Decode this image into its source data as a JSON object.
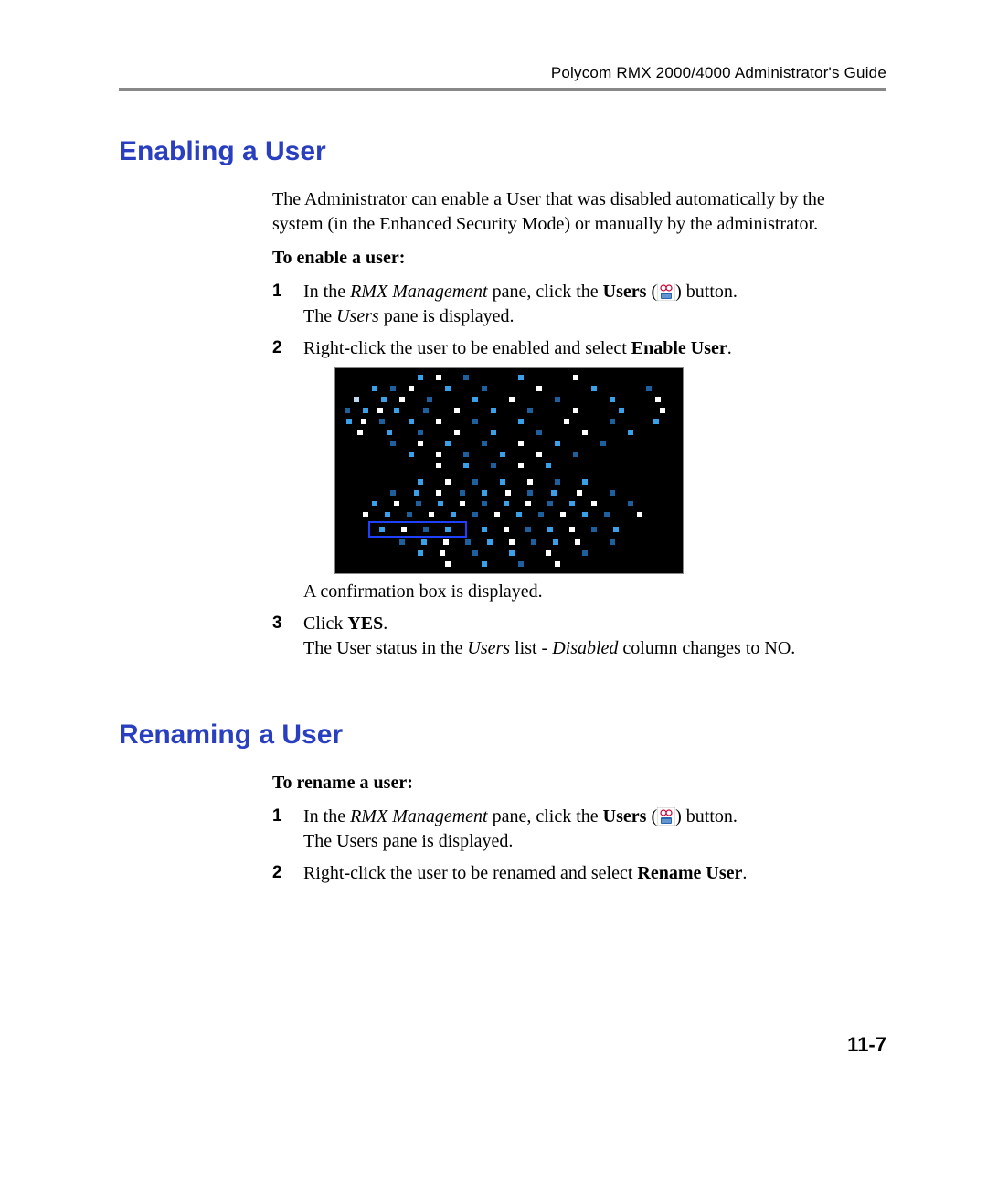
{
  "header": {
    "running_head": "Polycom RMX 2000/4000 Administrator's Guide"
  },
  "sections": {
    "enabling": {
      "title": "Enabling a User",
      "intro": "The Administrator can enable a User that was disabled automatically by the system (in the Enhanced Security Mode) or manually by the administrator.",
      "subhead": "To enable a user:",
      "steps": {
        "s1_pre": "In the ",
        "s1_italic": "RMX Management",
        "s1_mid": " pane, click the ",
        "s1_bold": "Users",
        "s1_paren_open": " (",
        "s1_paren_close": ") button.",
        "s1_line2_pre": "The ",
        "s1_line2_italic": "Users",
        "s1_line2_post": " pane is displayed.",
        "s2_pre": "Right-click the user to be enabled and select ",
        "s2_bold": "Enable User",
        "s2_post": ".",
        "s2_after_img": "A confirmation  box is displayed.",
        "s3_pre": "Click ",
        "s3_bold": "YES",
        "s3_post": ".",
        "s3_line2_pre": "The User status in the ",
        "s3_line2_italic1": "Users",
        "s3_line2_mid": " list - ",
        "s3_line2_italic2": "Disabled",
        "s3_line2_post": " column changes to NO."
      }
    },
    "renaming": {
      "title": "Renaming a User",
      "subhead": "To rename a user:",
      "steps": {
        "s1_pre": "In the ",
        "s1_italic": "RMX Management",
        "s1_mid": " pane, click the ",
        "s1_bold": "Users",
        "s1_paren_open": " (",
        "s1_paren_close": ") button.",
        "s1_line2": "The Users pane is displayed.",
        "s2_pre": "Right-click the user to be renamed and select ",
        "s2_bold": "Rename User",
        "s2_post": "."
      }
    }
  },
  "page_number": "11-7",
  "icons": {
    "users": "users-icon"
  }
}
